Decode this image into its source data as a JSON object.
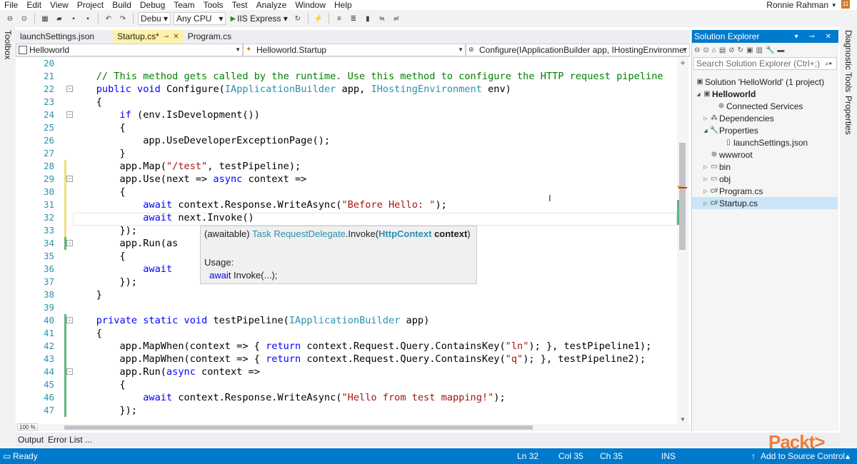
{
  "menu": {
    "items": [
      "File",
      "Edit",
      "View",
      "Project",
      "Build",
      "Debug",
      "Team",
      "Tools",
      "Test",
      "Analyze",
      "Window",
      "Help"
    ],
    "user": "Ronnie Rahman",
    "notification_badge": "11"
  },
  "toolbar": {
    "config": "Debu",
    "platform": "Any CPU",
    "run_target": "IIS Express"
  },
  "side": {
    "toolbox": "Toolbox",
    "diagnostic_tools": "Diagnostic Tools",
    "properties": "Properties"
  },
  "tabs": [
    {
      "label": "launchSettings.json",
      "active": false
    },
    {
      "label": "Startup.cs*",
      "active": true
    },
    {
      "label": "Program.cs",
      "active": false
    }
  ],
  "navbar": {
    "project": "Helloworld",
    "class": "Helloworld.Startup",
    "member": "Configure(IApplicationBuilder app, IHostingEnvironmer"
  },
  "line_numbers": [
    "20",
    "21",
    "22",
    "23",
    "24",
    "25",
    "26",
    "27",
    "28",
    "29",
    "30",
    "31",
    "32",
    "33",
    "34",
    "35",
    "36",
    "37",
    "38",
    "39",
    "40",
    "41",
    "42",
    "43",
    "44",
    "45",
    "46",
    "47"
  ],
  "code_lines": [
    "",
    "    // This method gets called by the runtime. Use this method to configure the HTTP request pipeline",
    "    public void Configure(IApplicationBuilder app, IHostingEnvironment env)",
    "    {",
    "        if (env.IsDevelopment())",
    "        {",
    "            app.UseDeveloperExceptionPage();",
    "        }",
    "        app.Map(\"/test\", testPipeline);",
    "        app.Use(next => async context =>",
    "        {",
    "            await context.Response.WriteAsync(\"Before Hello: \");",
    "            await next.Invoke()",
    "        });",
    "        app.Run(as",
    "        {",
    "            await",
    "        });",
    "    }",
    "",
    "    private static void testPipeline(IApplicationBuilder app)",
    "    {",
    "        app.MapWhen(context => { return context.Request.Query.ContainsKey(\"ln\"); }, testPipeline1);",
    "        app.MapWhen(context => { return context.Request.Query.ContainsKey(\"q\"); }, testPipeline2);",
    "        app.Run(async context =>",
    "        {",
    "            await context.Response.WriteAsync(\"Hello from test mapping!\");",
    "        });"
  ],
  "intellisense": {
    "prefix": "(awaitable) ",
    "type": "Task",
    "owner": "RequestDelegate",
    "method": ".Invoke(",
    "param_type": "HttpContext",
    "param_name": "context",
    "suffix": ")",
    "usage_label": "Usage:",
    "usage_keyword": "await",
    "usage_rest": " Invoke(...);"
  },
  "zoom": "100 %",
  "solution_explorer": {
    "title": "Solution Explorer",
    "search_placeholder": "Search Solution Explorer (Ctrl+;)",
    "nodes": [
      {
        "label": "Solution 'HelloWorld' (1 project)",
        "icon": "solution-icon",
        "expander": ""
      },
      {
        "label": "Helloworld",
        "icon": "csproject-icon",
        "expander": "◢"
      },
      {
        "label": "Connected Services",
        "icon": "connected-services-icon",
        "expander": ""
      },
      {
        "label": "Dependencies",
        "icon": "dependencies-icon",
        "expander": "▷"
      },
      {
        "label": "Properties",
        "icon": "wrench-icon",
        "expander": "◢"
      },
      {
        "label": "launchSettings.json",
        "icon": "json-file-icon",
        "expander": ""
      },
      {
        "label": "wwwroot",
        "icon": "globe-icon",
        "expander": ""
      },
      {
        "label": "bin",
        "icon": "folder-icon",
        "expander": "▷"
      },
      {
        "label": "obj",
        "icon": "folder-icon",
        "expander": "▷"
      },
      {
        "label": "Program.cs",
        "icon": "csharp-file-icon",
        "expander": "▷"
      },
      {
        "label": "Startup.cs",
        "icon": "csharp-file-icon",
        "expander": "▷"
      }
    ]
  },
  "bottom_tabs": [
    "Output",
    "Error List ..."
  ],
  "status": {
    "state": "Ready",
    "ln": "Ln 32",
    "col": "Col 35",
    "ch": "Ch 35",
    "mode": "INS",
    "source_control": "Add to Source Control"
  },
  "watermark": "Packt>",
  "colors": {
    "accent": "#007acc",
    "keyword": "#0000ff",
    "type": "#2b91af",
    "string": "#a31515",
    "comment": "#008000",
    "active_tab": "#fff1a8"
  }
}
